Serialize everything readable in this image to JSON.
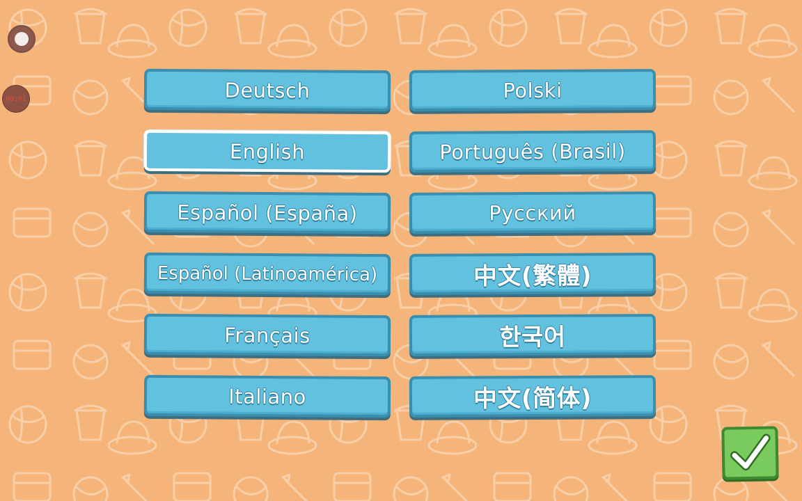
{
  "languages": [
    {
      "label": "Deutsch",
      "selected": false
    },
    {
      "label": "Polski",
      "selected": false
    },
    {
      "label": "English",
      "selected": true
    },
    {
      "label": "Português (Brasil)",
      "selected": false
    },
    {
      "label": "Español (España)",
      "selected": false
    },
    {
      "label": "Русский",
      "selected": false
    },
    {
      "label": "Español (Latinoamérica)",
      "selected": false
    },
    {
      "label": "中文(繁體)",
      "selected": false
    },
    {
      "label": "Français",
      "selected": false
    },
    {
      "label": "한국어",
      "selected": false
    },
    {
      "label": "Italiano",
      "selected": false
    },
    {
      "label": "中文(简体)",
      "selected": false
    }
  ],
  "recording": {
    "timer": "00:01"
  },
  "icons": {
    "confirm": "check-icon",
    "record": "record-icon"
  },
  "colors": {
    "background": "#f5b57a",
    "button": "#62c1df",
    "button_border": "#3b8fae",
    "selected_border": "#ffffff",
    "confirm": "#7acb5e"
  }
}
